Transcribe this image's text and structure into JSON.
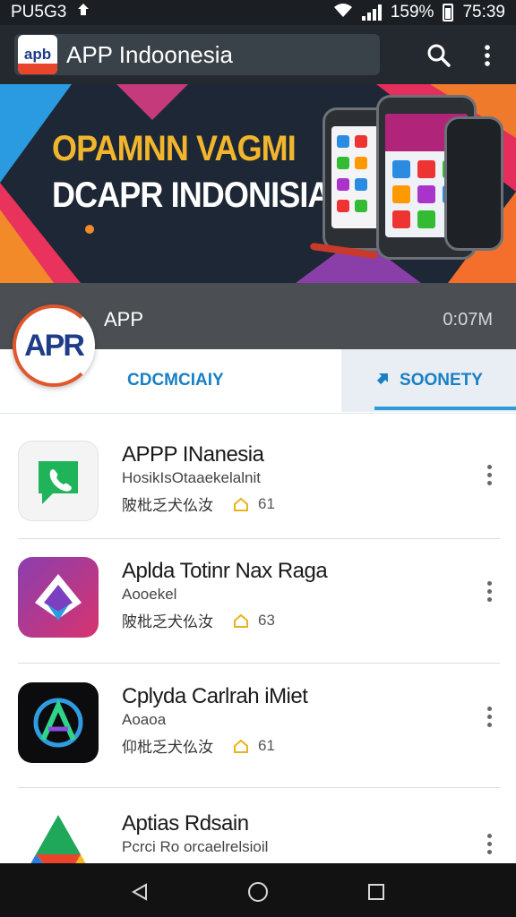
{
  "status_bar": {
    "carrier": "PU5G3",
    "battery": "159%",
    "time": "75:39"
  },
  "app_bar": {
    "logo_text": "apb",
    "title": "APP Indoonesia"
  },
  "banner": {
    "line1": "OPAMNN VAGMI",
    "line2": "DCAPR INDONISIA"
  },
  "header": {
    "logo_text": "APR",
    "name": "APP",
    "size": "0:07M"
  },
  "tabs": [
    {
      "label": "CDCMCIAIY"
    },
    {
      "label": "SOONETY"
    }
  ],
  "apps": [
    {
      "title": "APPP INanesia",
      "subtitle": "HosikIsOtaaekelalnit",
      "meta": "陂枇乏犬仫汝",
      "rating": "61"
    },
    {
      "title": "Aplda Totinr Nax Raga",
      "subtitle": "Aooekel",
      "meta": "陂枇乏犬仫汝",
      "rating": "63"
    },
    {
      "title": "Cplyda Carlrah iMiet",
      "subtitle": "Aoaoa",
      "meta": "仰枇乏犬仫汝",
      "rating": "61"
    },
    {
      "title": "Aptias Rdsain",
      "subtitle": "Pcrci Ro orcaelrelsioil",
      "meta": "",
      "rating": ""
    }
  ],
  "icons": {
    "search": "search-icon",
    "more": "more-vert-icon",
    "back": "back-triangle-icon",
    "home": "home-circle-icon",
    "recents": "recents-square-icon"
  },
  "colors": {
    "accent": "#1a7fc4",
    "banner_title": "#f1b62d",
    "app_bar": "#23292f"
  }
}
